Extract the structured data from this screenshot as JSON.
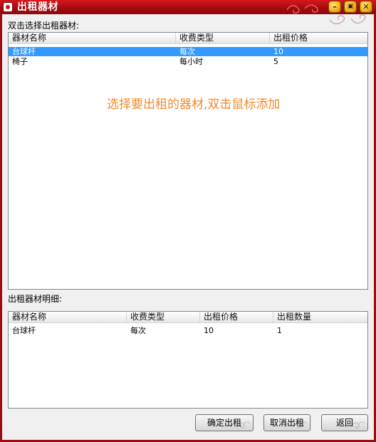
{
  "window": {
    "title": "出租器材",
    "minimize_glyph": "–",
    "restore_glyph": "▣",
    "close_glyph": "✕",
    "accent": "#b40f14"
  },
  "available": {
    "label": "双击选择出租器材:",
    "columns": [
      "器材名称",
      "收费类型",
      "出租价格"
    ],
    "rows": [
      {
        "name": "台球杆",
        "fee_type": "每次",
        "price": "10",
        "selected": true
      },
      {
        "name": "椅子",
        "fee_type": "每小时",
        "price": "5",
        "selected": false
      }
    ],
    "hint": "选择要出租的器材,双击鼠标添加",
    "hint_color": "#f08a2f",
    "selection_color": "#3399ff"
  },
  "details": {
    "label": "出租器材明细:",
    "columns": [
      "器材名称",
      "收费类型",
      "出租价格",
      "出租数量"
    ],
    "rows": [
      {
        "name": "台球杆",
        "fee_type": "每次",
        "price": "10",
        "qty": "1"
      }
    ]
  },
  "buttons": {
    "confirm": "确定出租",
    "cancel": "取消出租",
    "back": "返回"
  }
}
